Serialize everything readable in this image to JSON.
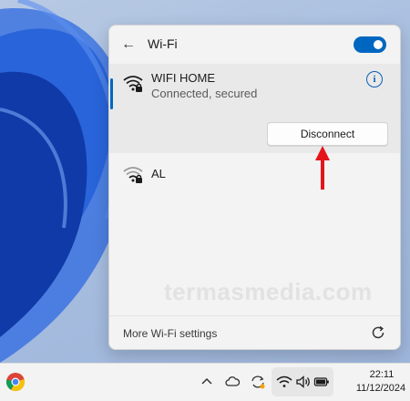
{
  "wifi_panel": {
    "title": "Wi-Fi",
    "toggle_on": true,
    "networks": [
      {
        "name": "WIFI HOME",
        "status": "Connected, secured",
        "action_label": "Disconnect",
        "icon": "wifi-secured-icon"
      },
      {
        "name": "AL",
        "icon": "wifi-secured-icon"
      }
    ],
    "footer_link": "More Wi-Fi settings"
  },
  "watermark": "termasmedia.com",
  "taskbar": {
    "time": "22:11",
    "date": "11/12/2024",
    "icons": [
      "chrome-icon",
      "chevron-up-icon",
      "cloud-icon",
      "sync-icon",
      "wifi-icon",
      "volume-icon",
      "battery-icon"
    ]
  },
  "colors": {
    "accent": "#0067c0",
    "arrow": "#e5141b"
  }
}
